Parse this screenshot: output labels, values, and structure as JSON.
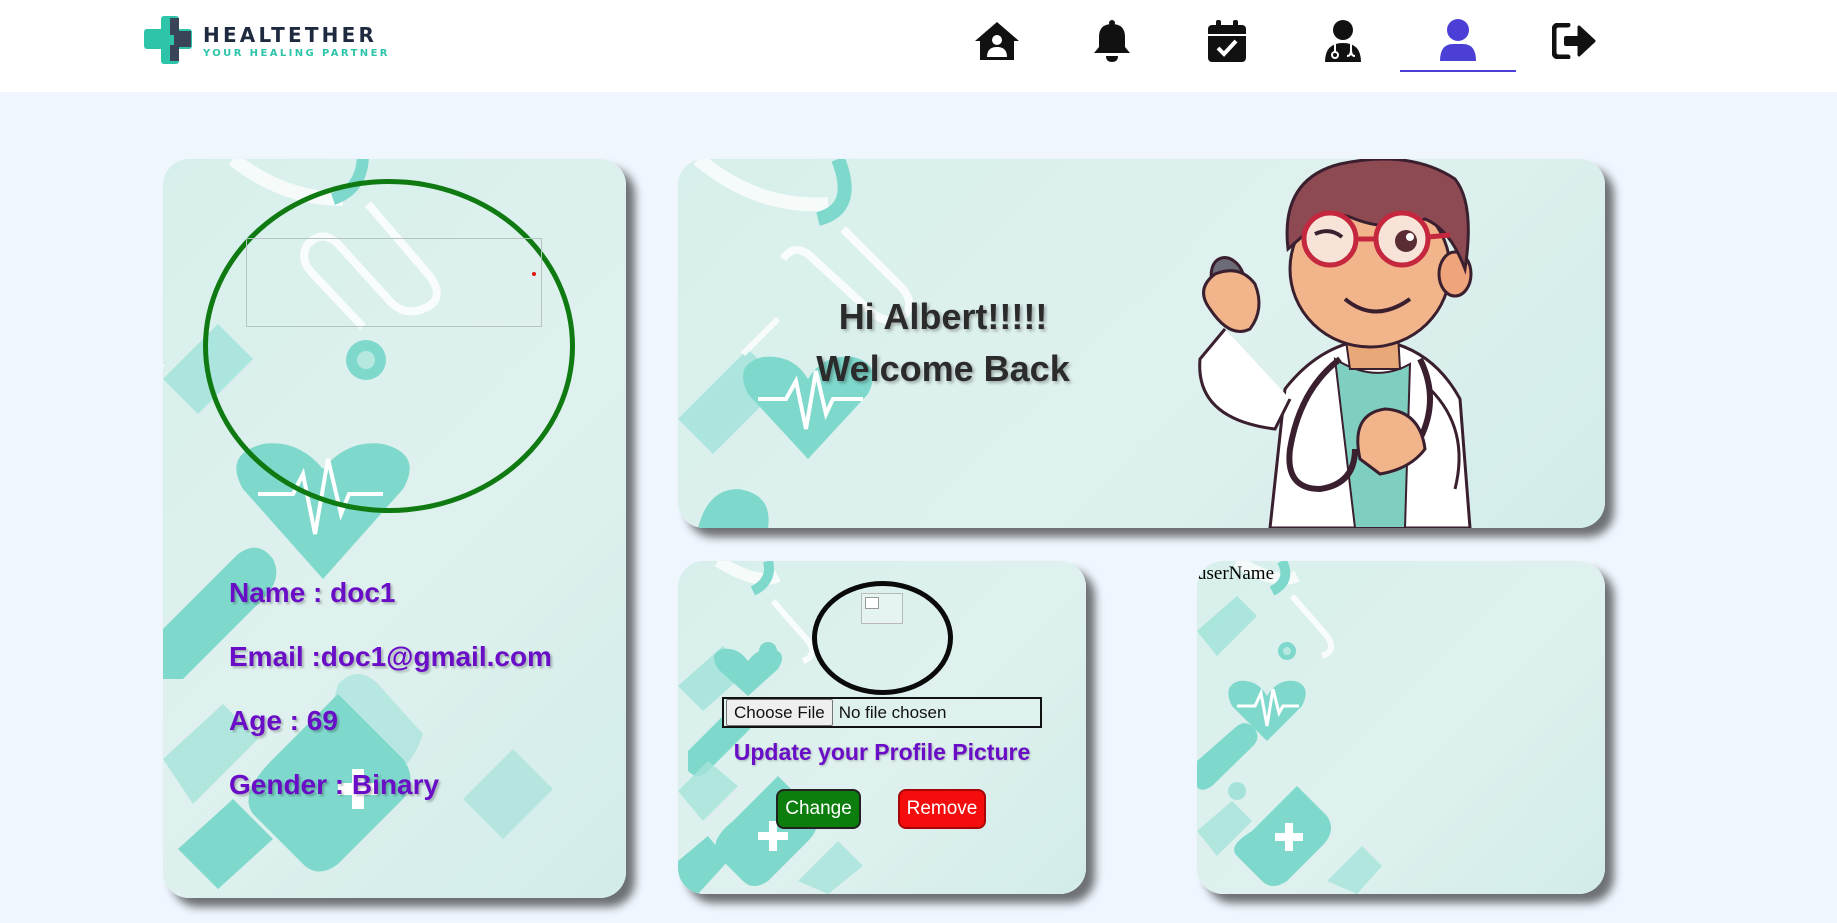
{
  "header": {
    "brand": "HEALTETHER",
    "tagline": "YOUR HEALING PARTNER",
    "nav": [
      {
        "icon": "home-user-icon",
        "label": "home"
      },
      {
        "icon": "bell-icon",
        "label": "notifications"
      },
      {
        "icon": "calendar-check-icon",
        "label": "appointments"
      },
      {
        "icon": "doctor-icon",
        "label": "doctors"
      },
      {
        "icon": "user-icon",
        "label": "profile",
        "active": true
      },
      {
        "icon": "logout-icon",
        "label": "logout"
      }
    ],
    "colors": {
      "active": "#4b3fd6",
      "icon": "#111111",
      "brand_accent": "#2ec4a9"
    }
  },
  "profile": {
    "name_line": "Name : doc1",
    "email_line": "Email :doc1@gmail.com",
    "age_line": "Age : 69",
    "gender_line": "Gender : Binary",
    "colors": {
      "text": "#6a0dc7",
      "ring": "#0f7a11"
    }
  },
  "welcome": {
    "line1": "Hi Albert!!!!!",
    "line2": "Welcome Back"
  },
  "upload": {
    "choose_label": "Choose File",
    "file_status": "No file chosen",
    "update_label": "Update your Profile Picture",
    "change_label": "Change",
    "remove_label": "Remove",
    "colors": {
      "change": "#0b7e0d",
      "remove": "#f30d0d"
    }
  },
  "username_card": {
    "label": "userName"
  }
}
